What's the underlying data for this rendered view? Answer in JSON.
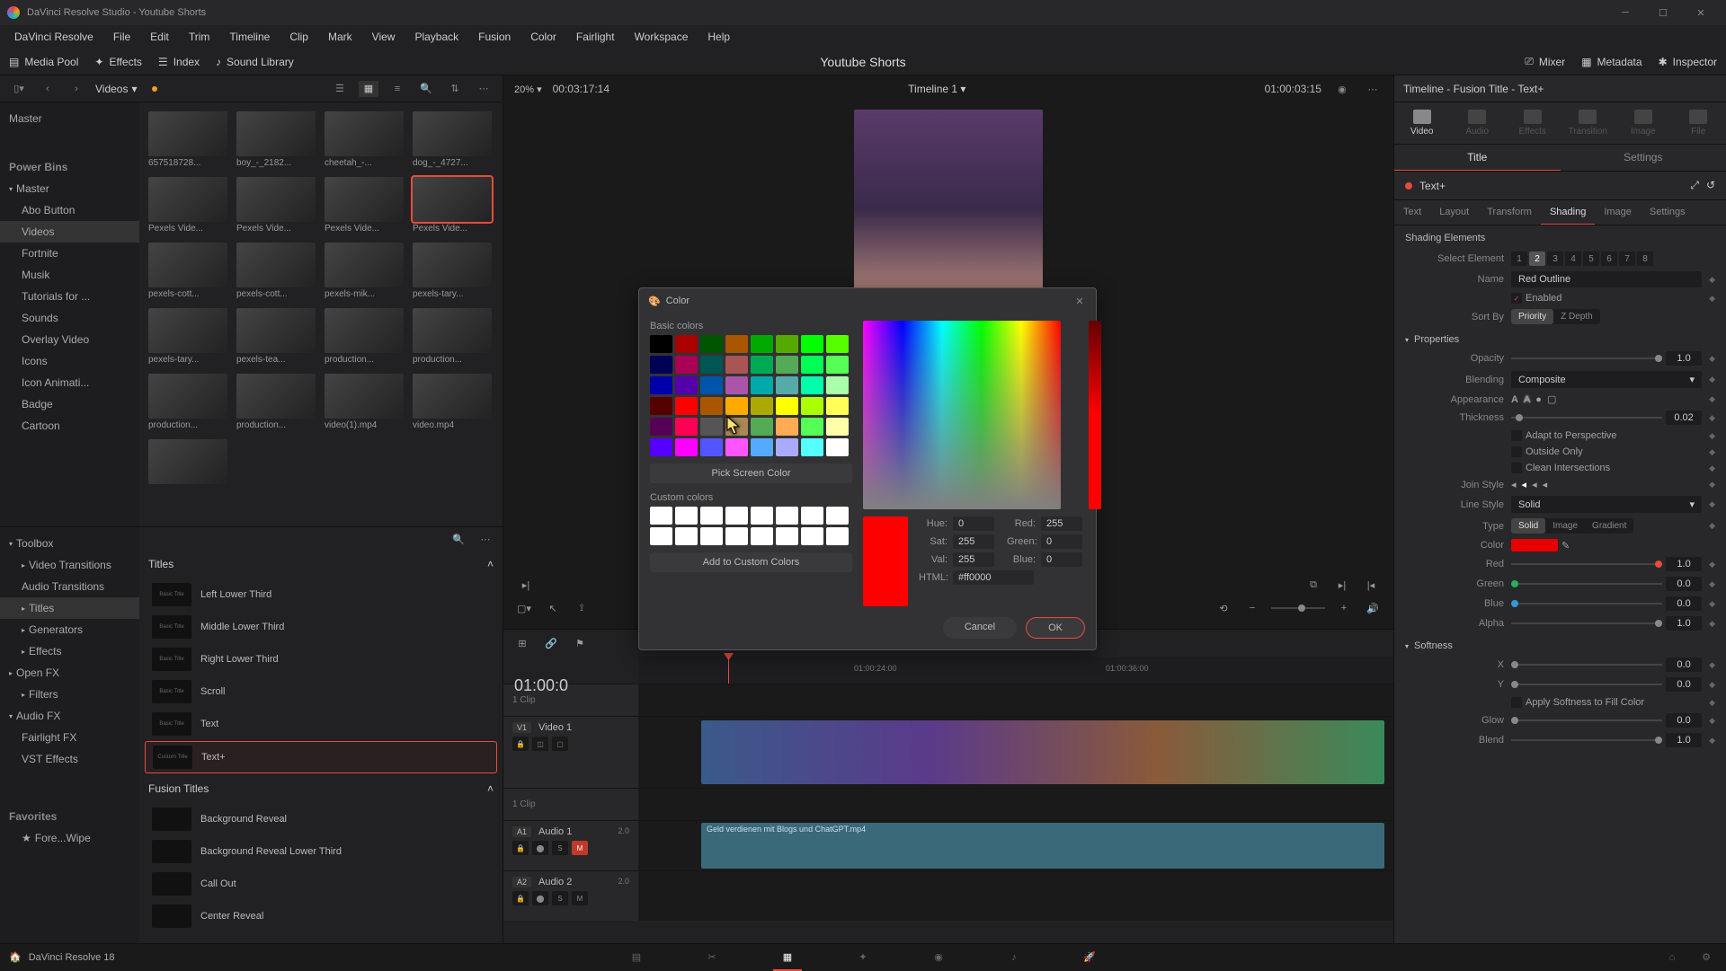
{
  "app": {
    "title": "DaVinci Resolve Studio - Youtube Shorts",
    "version_label": "DaVinci Resolve 18"
  },
  "menubar": [
    "DaVinci Resolve",
    "File",
    "Edit",
    "Trim",
    "Timeline",
    "Clip",
    "Mark",
    "View",
    "Playback",
    "Fusion",
    "Color",
    "Fairlight",
    "Workspace",
    "Help"
  ],
  "toolbar": {
    "media_pool": "Media Pool",
    "effects": "Effects",
    "index": "Index",
    "sound_lib": "Sound Library",
    "project": "Youtube Shorts",
    "mixer": "Mixer",
    "metadata": "Metadata",
    "inspector": "Inspector"
  },
  "media": {
    "dropdown": "Videos",
    "bins_heading1": "Master",
    "power_bins": "Power Bins",
    "bins": [
      "Master",
      "Abo Button",
      "Videos",
      "Fortnite",
      "Musik",
      "Tutorials for ...",
      "Sounds",
      "Overlay Video",
      "Icons",
      "Icon Animati...",
      "Badge",
      "Cartoon"
    ],
    "clips": [
      "657518728...",
      "boy_-_2182...",
      "cheetah_-...",
      "dog_-_4727...",
      "Pexels Vide...",
      "Pexels Vide...",
      "Pexels Vide...",
      "Pexels Vide...",
      "pexels-cott...",
      "pexels-cott...",
      "pexels-mik...",
      "pexels-tary...",
      "pexels-tary...",
      "pexels-tea...",
      "production...",
      "production...",
      "production...",
      "production...",
      "video(1).mp4",
      "video.mp4",
      ""
    ]
  },
  "toolbox": {
    "heading": "Toolbox",
    "items": [
      "Video Transitions",
      "Audio Transitions",
      "Titles",
      "Generators",
      "Effects"
    ],
    "openfx": "Open FX",
    "filters": "Filters",
    "audiofx": "Audio FX",
    "fairlight": "Fairlight FX",
    "vst": "VST Effects",
    "favorites": "Favorites",
    "fav1": "Fore...Wipe"
  },
  "titles": {
    "heading": "Titles",
    "items": [
      "Left Lower Third",
      "Middle Lower Third",
      "Right Lower Third",
      "Scroll",
      "Text",
      "Text+"
    ],
    "fusion_heading": "Fusion Titles",
    "fusion_items": [
      "Background Reveal",
      "Background Reveal Lower Third",
      "Call Out",
      "Center Reveal"
    ]
  },
  "viewer": {
    "zoom": "20%",
    "tc_left": "00:03:17:14",
    "title": "Timeline 1",
    "tc_right": "01:00:03:15"
  },
  "timeline": {
    "bigtc": "01:00:0",
    "ruler": [
      "01:00:24:00",
      "01:00:36:00"
    ],
    "v1": {
      "tag": "V1",
      "name": "Video 1",
      "clip_info": "1 Clip"
    },
    "a1": {
      "tag": "A1",
      "name": "Audio 1",
      "ch": "2.0",
      "clipname": "Geld verdienen mit Blogs und ChatGPT.mp4"
    },
    "a2": {
      "tag": "A2",
      "name": "Audio 2",
      "ch": "2.0"
    },
    "clip_count": "1 Clip"
  },
  "inspector": {
    "header": "Timeline - Fusion Title - Text+",
    "tabs": [
      "Video",
      "Audio",
      "Effects",
      "Transition",
      "Image",
      "File"
    ],
    "subtabs": [
      "Title",
      "Settings"
    ],
    "textplus": "Text+",
    "innertabs": [
      "Text",
      "Layout",
      "Transform",
      "Shading",
      "Image",
      "Settings"
    ],
    "shading_elems": "Shading Elements",
    "select_elem": "Select Element",
    "name_label": "Name",
    "name_val": "Red Outline",
    "enabled": "Enabled",
    "sortby": "Sort By",
    "priority": "Priority",
    "zdepth": "Z Depth",
    "properties": "Properties",
    "opacity": "Opacity",
    "opacity_v": "1.0",
    "blending": "Blending",
    "blending_v": "Composite",
    "appearance": "Appearance",
    "thickness": "Thickness",
    "thickness_v": "0.02",
    "adapt": "Adapt to Perspective",
    "outside": "Outside Only",
    "clean": "Clean Intersections",
    "joinstyle": "Join Style",
    "linestyle": "Line Style",
    "linestyle_v": "Solid",
    "type": "Type",
    "type_solid": "Solid",
    "type_image": "Image",
    "type_gradient": "Gradient",
    "color": "Color",
    "red": "Red",
    "red_v": "1.0",
    "green": "Green",
    "green_v": "0.0",
    "blue": "Blue",
    "blue_v": "0.0",
    "alpha": "Alpha",
    "alpha_v": "1.0",
    "softness": "Softness",
    "x": "X",
    "x_v": "0.0",
    "y": "Y",
    "y_v": "0.0",
    "applysoft": "Apply Softness to Fill Color",
    "glow": "Glow",
    "glow_v": "0.0",
    "blend": "Blend",
    "blend_v": "1.0"
  },
  "colordlg": {
    "title": "Color",
    "basic": "Basic colors",
    "pick": "Pick Screen Color",
    "custom": "Custom colors",
    "add": "Add to Custom Colors",
    "hue": "Hue:",
    "hue_v": "0",
    "sat": "Sat:",
    "sat_v": "255",
    "val": "Val:",
    "val_v": "255",
    "r": "Red:",
    "r_v": "255",
    "g": "Green:",
    "g_v": "0",
    "b": "Blue:",
    "b_v": "0",
    "html": "HTML:",
    "html_v": "#ff0000",
    "cancel": "Cancel",
    "ok": "OK",
    "swatches": [
      "#000000",
      "#aa0000",
      "#005500",
      "#aa5500",
      "#00aa00",
      "#55aa00",
      "#00ff00",
      "#55ff00",
      "#000055",
      "#aa0055",
      "#005555",
      "#aa5555",
      "#00aa55",
      "#55aa55",
      "#00ff55",
      "#55ff55",
      "#0000aa",
      "#5500aa",
      "#0055aa",
      "#aa55aa",
      "#00aaaa",
      "#55aaaa",
      "#00ffaa",
      "#aaffaa",
      "#550000",
      "#ff0000",
      "#aa5500",
      "#ffaa00",
      "#aaaa00",
      "#ffff00",
      "#aaff00",
      "#ffff55",
      "#550055",
      "#ff0055",
      "#555555",
      "#aa8855",
      "#55aa55",
      "#ffaa55",
      "#55ff55",
      "#ffffaa",
      "#5500ff",
      "#ff00ff",
      "#5555ff",
      "#ff55ff",
      "#55aaff",
      "#aaaaff",
      "#55ffff",
      "#ffffff"
    ]
  }
}
